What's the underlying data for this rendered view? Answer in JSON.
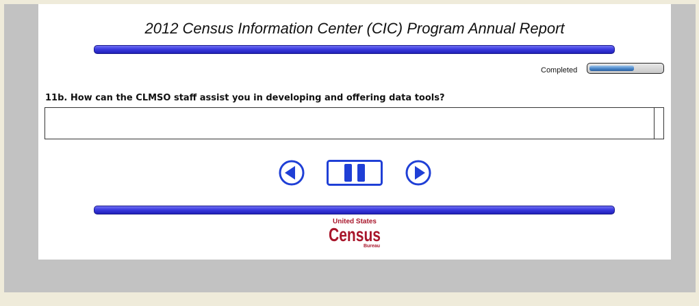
{
  "survey": {
    "title": "2012 Census Information Center (CIC) Program Annual Report",
    "progress_label": "Completed",
    "progress_fraction": 0.62,
    "question": "11b. How can the CLMSO staff assist you in developing and offering data tools?",
    "answer_value": ""
  },
  "nav": {
    "prev_icon": "previous-arrow-icon",
    "pause_icon": "pause-icon",
    "next_icon": "next-arrow-icon"
  },
  "footer": {
    "logo_top": "United States",
    "logo_main": "Census",
    "logo_bottom": "Bureau"
  },
  "colors": {
    "accent_bar": "#3b3be0",
    "nav_blue": "#1f3fd6",
    "logo_red": "#a8162b",
    "background": "#efebda",
    "frame": "#c2c2c2"
  }
}
